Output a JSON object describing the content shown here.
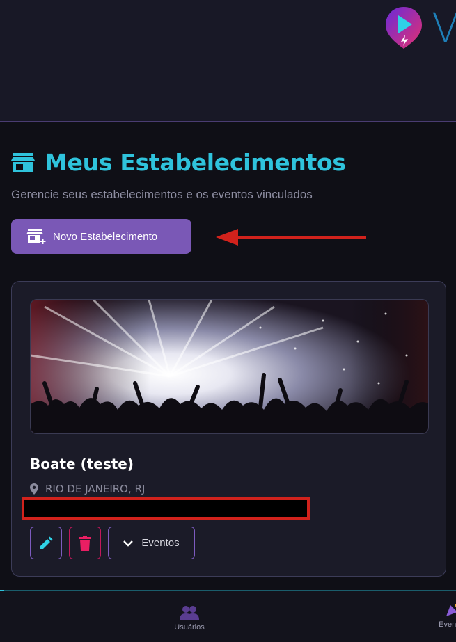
{
  "header": {
    "logo_text": "V",
    "logo_icon": "play-pin-logo-icon"
  },
  "page": {
    "title": "Meus Estabelecimentos",
    "title_icon": "store-icon",
    "subtitle": "Gerencie seus estabelecimentos e os eventos vinculados"
  },
  "actions": {
    "new_button_label": "Novo Estabelecimento",
    "new_button_icon": "store-add-icon"
  },
  "card": {
    "title": "Boate (teste)",
    "location": "RIO DE JANEIRO, RJ",
    "location_icon": "map-pin-icon",
    "image": "concert-crowd-photo",
    "buttons": {
      "edit_icon": "pencil-icon",
      "delete_icon": "trash-icon",
      "events_label": "Eventos",
      "events_icon": "chevron-down-icon"
    }
  },
  "bottom_nav": {
    "items": [
      {
        "label": "Usuários",
        "icon": "users-icon"
      },
      {
        "label": "Eventos",
        "icon": "party-icon"
      }
    ]
  },
  "colors": {
    "accent_cyan": "#2fc3dc",
    "accent_purple": "#7a58b6",
    "danger_pink": "#e91e63",
    "annotation_red": "#d1221c",
    "background": "#0f0f16"
  }
}
